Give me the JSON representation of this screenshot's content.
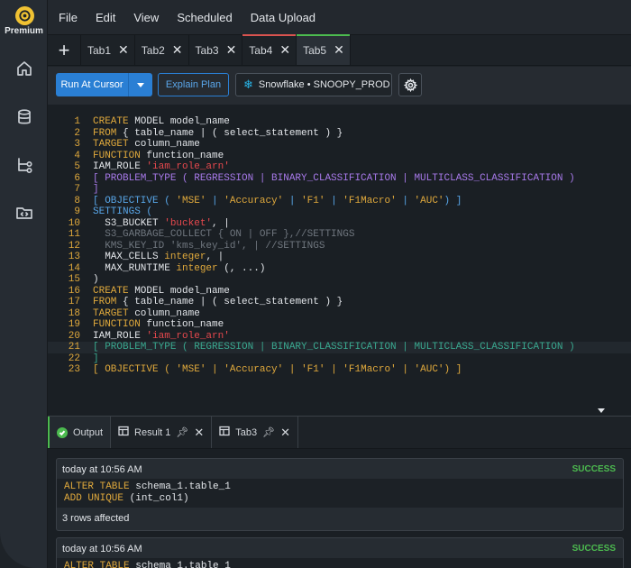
{
  "sidebar": {
    "brand": "Premium",
    "icons": [
      "home-icon",
      "database-icon",
      "schema-icon",
      "folder-icon"
    ]
  },
  "menu": [
    "File",
    "Edit",
    "View",
    "Scheduled",
    "Data Upload"
  ],
  "tabs": [
    {
      "label": "Tab1",
      "state": "normal"
    },
    {
      "label": "Tab2",
      "state": "normal"
    },
    {
      "label": "Tab3",
      "state": "normal"
    },
    {
      "label": "Tab4",
      "state": "modified"
    },
    {
      "label": "Tab5",
      "state": "active"
    }
  ],
  "toolbar": {
    "run_label": "Run At Cursor",
    "explain_label": "Explain Plan",
    "connection_label": "Snowflake • SNOOPY_PROD"
  },
  "editor": {
    "current_line": 21,
    "lines": [
      [
        [
          "CREATE",
          "k-orange"
        ],
        [
          " MODEL model_name",
          "k-plain"
        ]
      ],
      [
        [
          "FROM",
          "k-orange"
        ],
        [
          " { table_name | ( select_statement ) }",
          "k-plain"
        ]
      ],
      [
        [
          "TARGET",
          "k-orange"
        ],
        [
          " column_name",
          "k-plain"
        ]
      ],
      [
        [
          "FUNCTION",
          "k-orange"
        ],
        [
          " function_name",
          "k-plain"
        ]
      ],
      [
        [
          "IAM_ROLE ",
          "k-plain"
        ],
        [
          "'iam_role_arn'",
          "k-red"
        ]
      ],
      [
        [
          "[ PROBLEM_TYPE ( REGRESSION | BINARY_CLASSIFICATION | MULTICLASS_CLASSIFICATION )",
          "k-purple"
        ]
      ],
      [
        [
          "]",
          "k-purple"
        ]
      ],
      [
        [
          "[ OBJECTIVE ( ",
          "k-blue"
        ],
        [
          "'MSE'",
          "k-orange"
        ],
        [
          " | ",
          "k-blue"
        ],
        [
          "'Accuracy'",
          "k-orange"
        ],
        [
          " | ",
          "k-blue"
        ],
        [
          "'F1'",
          "k-orange"
        ],
        [
          " | ",
          "k-blue"
        ],
        [
          "'F1Macro'",
          "k-orange"
        ],
        [
          " | ",
          "k-blue"
        ],
        [
          "'AUC'",
          "k-orange"
        ],
        [
          ") ]",
          "k-blue"
        ]
      ],
      [
        [
          "SETTINGS (",
          "k-blue"
        ]
      ],
      [
        [
          "  S3_BUCKET ",
          "k-plain"
        ],
        [
          "'bucket'",
          "k-red"
        ],
        [
          ", |",
          "k-plain"
        ]
      ],
      [
        [
          "  S3_GARBAGE_COLLECT { ON | OFF },//SETTINGS",
          "k-dim"
        ]
      ],
      [
        [
          "  KMS_KEY_ID 'kms_key_id', | //SETTINGS",
          "k-dim"
        ]
      ],
      [
        [
          "  MAX_CELLS ",
          "k-plain"
        ],
        [
          "integer",
          "k-orange"
        ],
        [
          ", |",
          "k-plain"
        ]
      ],
      [
        [
          "  MAX_RUNTIME ",
          "k-plain"
        ],
        [
          "integer",
          "k-orange"
        ],
        [
          " (, ...)",
          "k-plain"
        ]
      ],
      [
        [
          ")",
          "k-plain"
        ]
      ],
      [
        [
          "CREATE",
          "k-orange"
        ],
        [
          " MODEL model_name",
          "k-plain"
        ]
      ],
      [
        [
          "FROM",
          "k-orange"
        ],
        [
          " { table_name | ( select_statement ) }",
          "k-plain"
        ]
      ],
      [
        [
          "TARGET",
          "k-orange"
        ],
        [
          " column_name",
          "k-plain"
        ]
      ],
      [
        [
          "FUNCTION",
          "k-orange"
        ],
        [
          " function_name",
          "k-plain"
        ]
      ],
      [
        [
          "IAM_ROLE ",
          "k-plain"
        ],
        [
          "'iam_role_arn'",
          "k-red"
        ]
      ],
      [
        [
          "[ PROBLEM_TYPE ( REGRESSION | BINARY_CLASSIFICATION | MULTICLASS_CLASSIFICATION )",
          "k-teal"
        ]
      ],
      [
        [
          "]",
          "k-teal"
        ]
      ],
      [
        [
          "[ OBJECTIVE ( ",
          "k-orange"
        ],
        [
          "'MSE'",
          "k-orange"
        ],
        [
          " | ",
          "k-orange"
        ],
        [
          "'Accuracy'",
          "k-orange"
        ],
        [
          " | ",
          "k-orange"
        ],
        [
          "'F1'",
          "k-orange"
        ],
        [
          " | ",
          "k-orange"
        ],
        [
          "'F1Macro'",
          "k-orange"
        ],
        [
          " | ",
          "k-orange"
        ],
        [
          "'AUC'",
          "k-orange"
        ],
        [
          ") ]",
          "k-orange"
        ]
      ]
    ]
  },
  "output_tabs": [
    {
      "label": "Output",
      "icon": "success-icon"
    },
    {
      "label": "Result 1",
      "icon": "grid-icon"
    },
    {
      "label": "Tab3",
      "icon": "grid-icon"
    }
  ],
  "results": [
    {
      "time": "today at 10:56 AM",
      "status": "SUCCESS",
      "code": [
        [
          [
            "ALTER TABLE",
            "k-orange"
          ],
          [
            " schema_1.table_1",
            "k-plain"
          ]
        ],
        [
          [
            "ADD UNIQUE",
            "k-orange"
          ],
          [
            " (int_col1)",
            "k-plain"
          ]
        ]
      ],
      "footer": "3 rows affected"
    },
    {
      "time": "today at 10:56 AM",
      "status": "SUCCESS",
      "code": [
        [
          [
            "ALTER TABLE",
            "k-orange"
          ],
          [
            " schema_1.table_1",
            "k-plain"
          ]
        ]
      ],
      "footer": ""
    }
  ]
}
